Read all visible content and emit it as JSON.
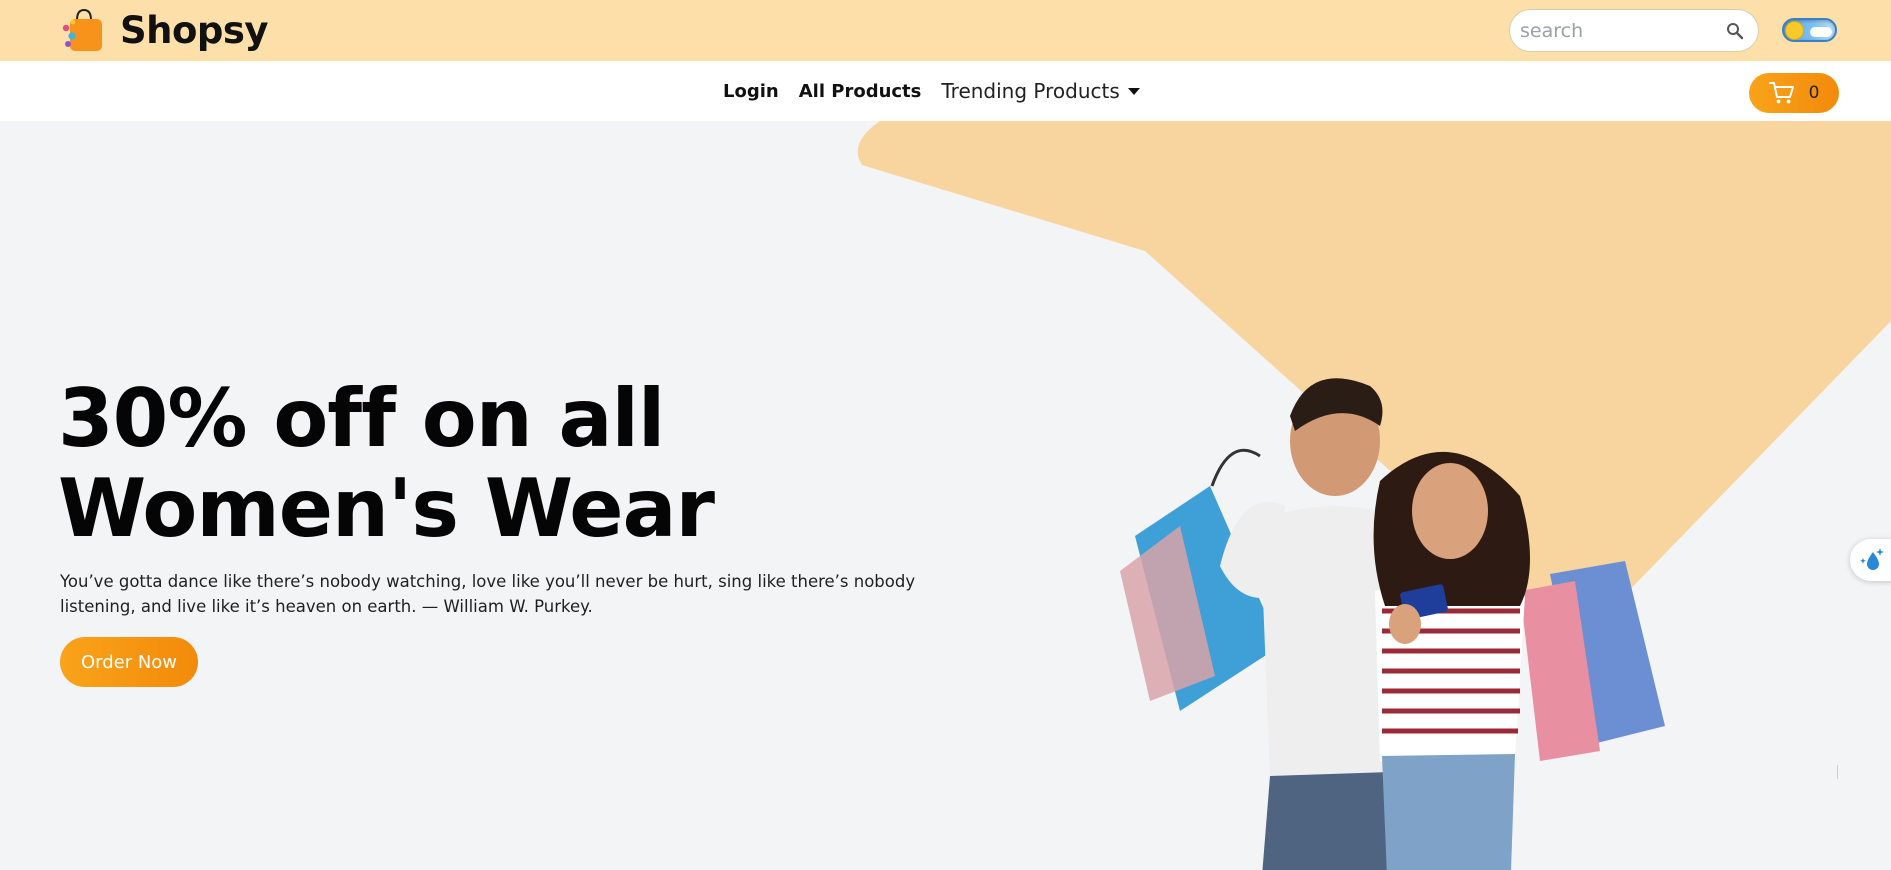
{
  "header": {
    "brand_name": "Shopsy",
    "search": {
      "placeholder": "search",
      "value": ""
    }
  },
  "nav": {
    "login_label": "Login",
    "all_products_label": "All Products",
    "trending_label": "Trending Products",
    "cart_count": "0"
  },
  "hero": {
    "title_line1": "30% off on all",
    "title_line2": "Women's Wear",
    "quote": "You’ve gotta dance like there’s nobody watching, love like you’ll never be hurt, sing like there’s nobody listening, and live like it’s heaven on earth. — William W. Purkey.",
    "cta_label": "Order Now"
  },
  "colors": {
    "header_bg": "#fde0a9",
    "accent": "#f79a12",
    "hero_bg": "#f3f4f6",
    "hero_shape": "#f8d59f"
  },
  "icons": {
    "logo": "shopping-bag-icon",
    "search": "search-icon",
    "cart": "cart-icon",
    "dropdown": "caret-down-icon",
    "accessibility": "accessibility-icon"
  }
}
